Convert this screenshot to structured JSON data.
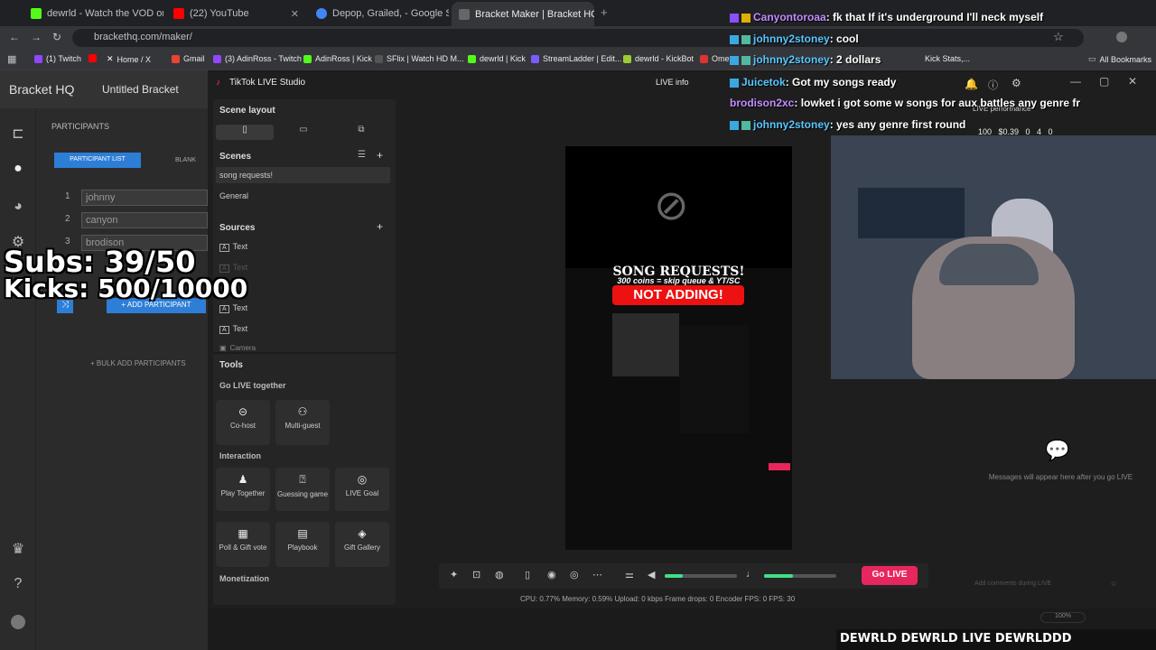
{
  "tabs": [
    {
      "label": "dewrld - Watch the VOD on Kic",
      "color": "#53fc18"
    },
    {
      "label": "(22) YouTube",
      "color": "#ff0000"
    },
    {
      "label": "Depop, Grailed, - Google Searc",
      "color": "#4285f4"
    },
    {
      "label": "Bracket Maker | Bracket HQ",
      "color": "#666666"
    }
  ],
  "url": "brackethq.com/maker/",
  "bookmarks": [
    "(1) Twitch",
    "Home / X",
    "Gmail",
    "(3) AdinRoss - Twitch",
    "AdinRoss | Kick",
    "SFlix | Watch HD M...",
    "dewrld | Kick",
    "StreamLadder | Edit...",
    "dewrld - KickBot",
    "Ome",
    "Kick Stats,...",
    "All Bookmarks"
  ],
  "bracket": {
    "brand": "Bracket HQ",
    "title": "Untitled Bracket",
    "section": "PARTICIPANTS",
    "tab_list": "PARTICIPANT LIST",
    "tab_blank": "BLANK",
    "participants": [
      "johnny",
      "canyon",
      "brodison"
    ],
    "add_btn": "+ ADD PARTICIPANT",
    "bulk_btn": "+ BULK ADD PARTICIPANTS"
  },
  "studio": {
    "title": "TikTok LIVE Studio",
    "live_info": "LIVE info",
    "scene_layout": "Scene layout",
    "scenes_label": "Scenes",
    "scenes": [
      "song requests!",
      "General"
    ],
    "sources_label": "Sources",
    "sources": [
      "Text",
      "Text",
      "Text",
      "Text",
      "Camera"
    ],
    "tools_label": "Tools",
    "go_live_together": "Go LIVE together",
    "cohost": "Co-host",
    "multiguest": "Multi-guest",
    "interaction": "Interaction",
    "play_together": "Play Together",
    "guessing": "Guessing game",
    "live_goal": "LIVE Goal",
    "poll": "Poll & Gift vote",
    "playbook": "Playbook",
    "gift_gallery": "Gift Gallery",
    "monetization": "Monetization",
    "preview_title": "SONG REQUESTS!",
    "preview_sub": "300 coins = skip queue & YT/SC",
    "preview_badge": "NOT ADDING!",
    "go_live": "Go LIVE",
    "stats": "CPU: 0.77%     Memory: 0.59%     Upload: 0 kbps     Frame drops: 0     Encoder FPS: 0     FPS: 30",
    "live_performance": "LIVE performance",
    "perf": "100   $0.39   0   4   0",
    "messages_empty": "Messages will appear here after you go LIVE",
    "comment_placeholder": "Add comments during LIVE",
    "zoom": "100%"
  },
  "overlay": {
    "subs": "Subs: 39/50",
    "kicks": "Kicks: 500/10000"
  },
  "chat": [
    {
      "name": "Canyontoroaa",
      "text": ": fk that If it's underground I'll neck myself",
      "purple": true
    },
    {
      "name": "johnny2stoney",
      "text": ": cool",
      "purple": false
    },
    {
      "name": "johnny2stoney",
      "text": ": 2 dollars",
      "purple": false
    },
    {
      "name": "Juicetok",
      "text": ": Got my songs ready",
      "purple": false
    },
    {
      "name": "brodison2xc",
      "text": ": lowket i got some w songs for aux battles any genre fr",
      "purple": true
    },
    {
      "name": "johnny2stoney",
      "text": ": yes any genre first round",
      "purple": false
    }
  ],
  "banner": "DEWRLD   DEWRLD LIVE   DEWRLDDD"
}
